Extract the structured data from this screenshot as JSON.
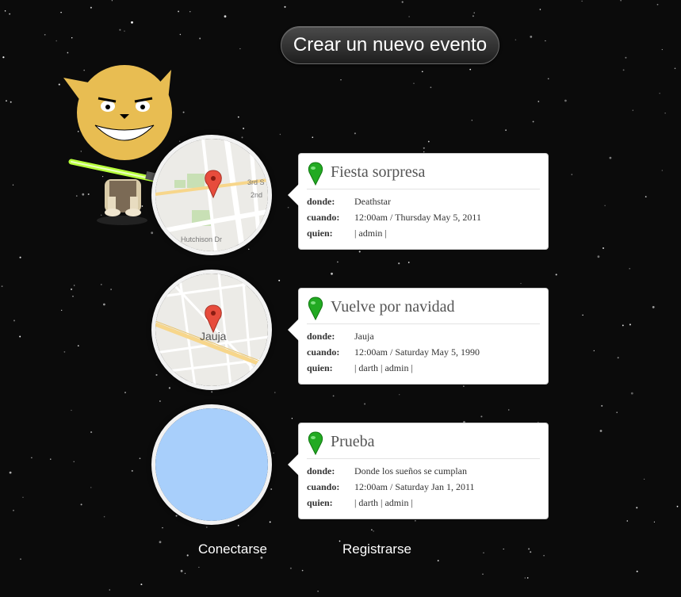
{
  "header": {
    "create_button": "Crear un nuevo evento"
  },
  "mascot": {
    "description_icon": "jedi-cat-mascot"
  },
  "labels": {
    "where": "donde:",
    "when": "cuando:",
    "who": "quien:"
  },
  "events": [
    {
      "title": "Fiesta sorpresa",
      "where": "Deathstar",
      "when": "12:00am / Thursday May 5, 2011",
      "who": "| admin |",
      "map": {
        "type": "street-map",
        "streets": [
          "3rd S",
          "2nd",
          "Hutchison Dr"
        ]
      }
    },
    {
      "title": "Vuelve por navidad",
      "where": "Jauja",
      "when": "12:00am / Saturday May 5, 1990",
      "who": "| darth | admin |",
      "map": {
        "type": "town-map",
        "town": "Jauja"
      }
    },
    {
      "title": "Prueba",
      "where": "Donde los sueños se cumplan",
      "when": "12:00am / Saturday Jan 1, 2011",
      "who": "| darth | admin |",
      "map": {
        "type": "empty-map",
        "fill": "#a8cffb"
      }
    }
  ],
  "footer": {
    "login": "Conectarse",
    "register": "Registrarse"
  },
  "colors": {
    "background": "#0b0b0b",
    "pin_green": "#22aa22",
    "lightsaber": "#b6ff3a",
    "mascot": "#e8bd52"
  }
}
